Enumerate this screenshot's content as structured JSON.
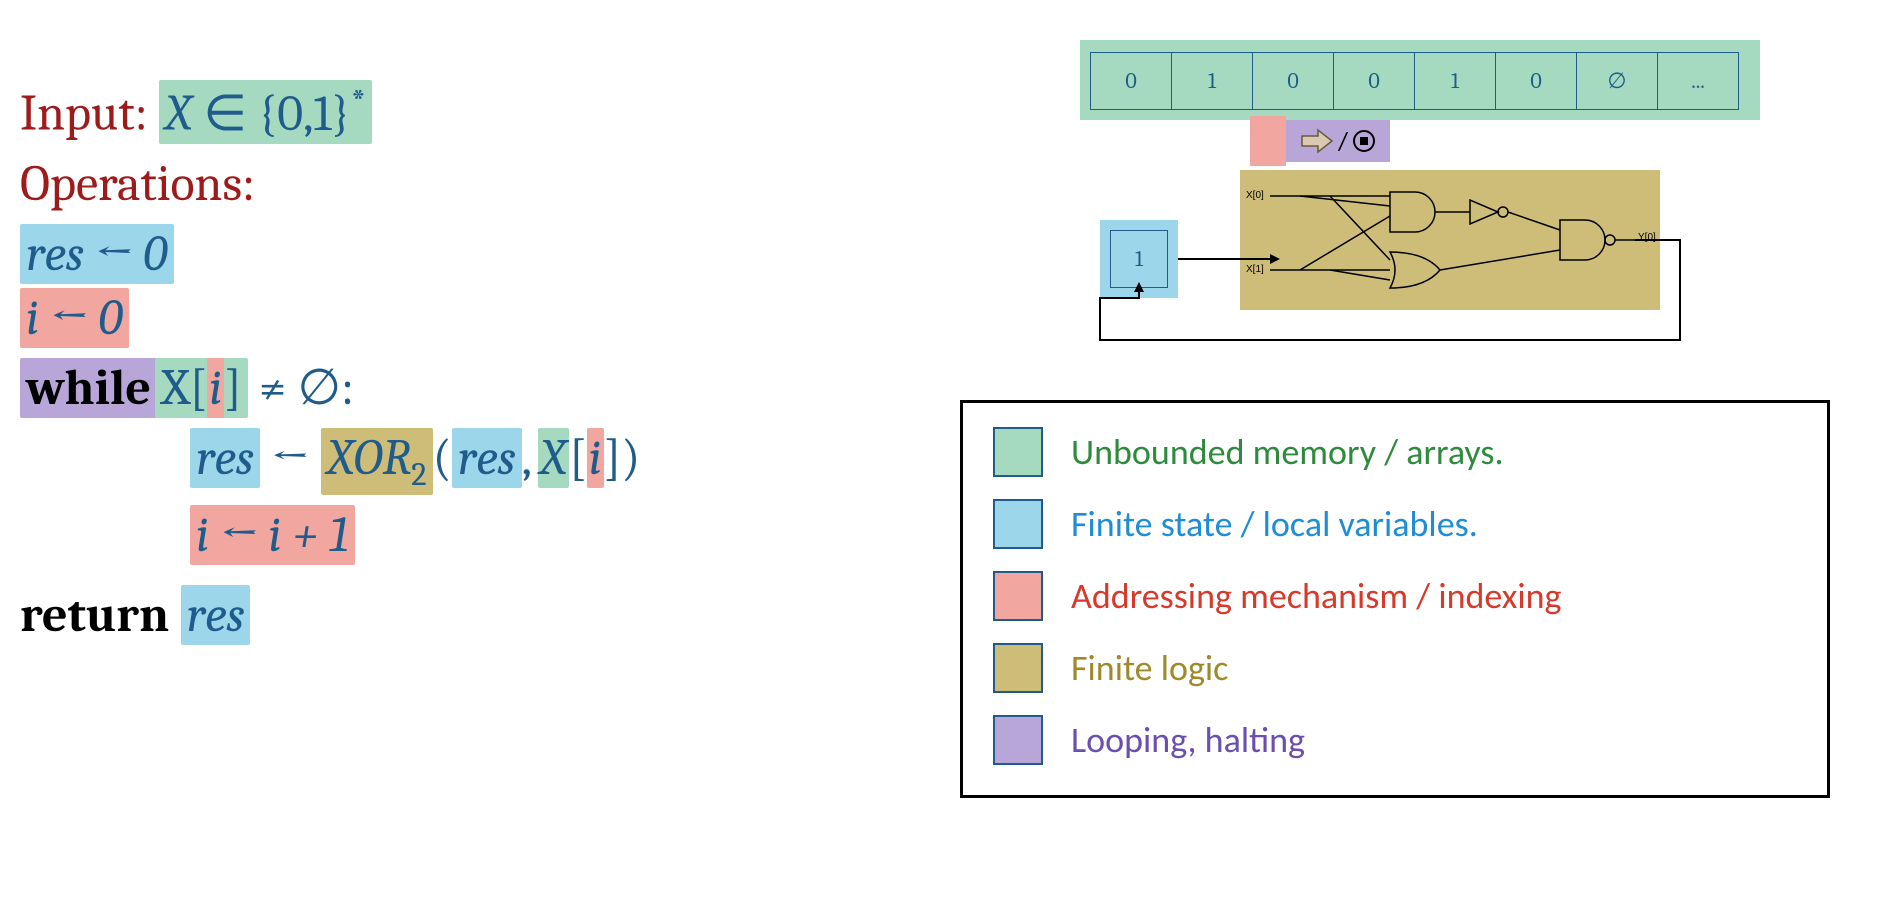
{
  "code": {
    "input_label": "Input:",
    "input_expr": "X ∈ {0,1}*",
    "operations_label": "Operations:",
    "res_init": "res ← 0",
    "i_init": "i ← 0",
    "while_kw": "while",
    "while_X": "X[",
    "while_i": "i",
    "while_close": "]",
    "while_rest": " ≠ ∅:",
    "line5_res": "res",
    "line5_arrow": " ← ",
    "line5_xor": "XOR",
    "line5_sub": "2",
    "line5_open": "(",
    "line5_res2": "res",
    "line5_comma": ",",
    "line5_X": "X",
    "line5_lb": "[",
    "line5_i": "i",
    "line5_rb": "]",
    "line5_close": ")",
    "i_inc": "i ← i + 1",
    "return_kw": "return",
    "return_res": "res"
  },
  "tape": [
    "0",
    "1",
    "0",
    "0",
    "1",
    "0",
    "∅",
    "..."
  ],
  "head": {
    "slash": "/",
    "halt": "⊙"
  },
  "circuit": {
    "x0": "X[0]",
    "x1": "X[1]",
    "y0": "Y[0]"
  },
  "state": "1",
  "legend": {
    "memory": "Unbounded memory  / arrays.",
    "state": "Finite state / local variables.",
    "addr": "Addressing mechanism / indexing",
    "logic": "Finite logic",
    "loop": "Looping, halting"
  },
  "colors": {
    "green": "#a5d9c0",
    "blue": "#9cd6ea",
    "red": "#f1a7a0",
    "olive": "#cdbd79",
    "purple": "#b9a6d9"
  }
}
